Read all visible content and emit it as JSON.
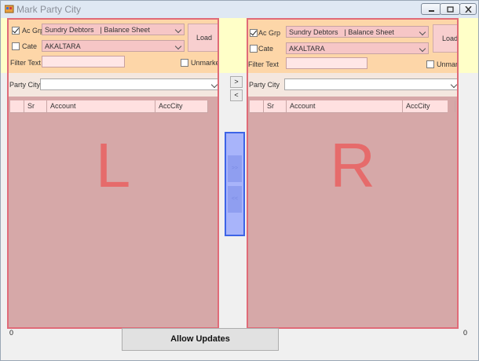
{
  "window": {
    "title": "Mark Party City",
    "colors": {
      "titlebar": "#dfe8f3",
      "panel_border": "#e06b78",
      "panel_fill": "#d6a8a8",
      "letter": "#e66b6b",
      "middle_strip": "#a8b4fa"
    }
  },
  "left": {
    "ac_grp_label": "Ac Grp",
    "ac_grp_checked": true,
    "ac_grp_value": "Sundry Debtors",
    "ac_grp_value2": "| Balance Sheet",
    "cate_label": "Cate",
    "cate_checked": false,
    "cate_value": "AKALTARA",
    "load_label": "Load",
    "filter_label": "Filter Text",
    "filter_value": "",
    "unmarked_label": "Unmarked",
    "unmarked_checked": false,
    "party_city_label": "Party City",
    "party_city_value": "",
    "columns": [
      "Sr",
      "Account",
      "AccCity"
    ],
    "big_letter": "L",
    "count": "0"
  },
  "right": {
    "ac_grp_label": "Ac Grp",
    "ac_grp_checked": true,
    "ac_grp_value": "Sundry Debtors",
    "ac_grp_value2": "| Balance Sheet",
    "cate_label": "Cate",
    "cate_checked": false,
    "cate_value": "AKALTARA",
    "load_label": "Load",
    "filter_label": "Filter Text",
    "filter_value": "",
    "unmarked_label": "Unmarked",
    "unmarked_checked": false,
    "party_city_label": "Party City",
    "party_city_value": "",
    "columns": [
      "Sr",
      "Account",
      "AccCity"
    ],
    "big_letter": "R",
    "count": "0"
  },
  "middle": {
    "move_right_label": ">",
    "move_left_label": "<",
    "strip_button1": ">>",
    "strip_button2": "<<"
  },
  "footer": {
    "allow_updates_label": "Allow Updates"
  }
}
